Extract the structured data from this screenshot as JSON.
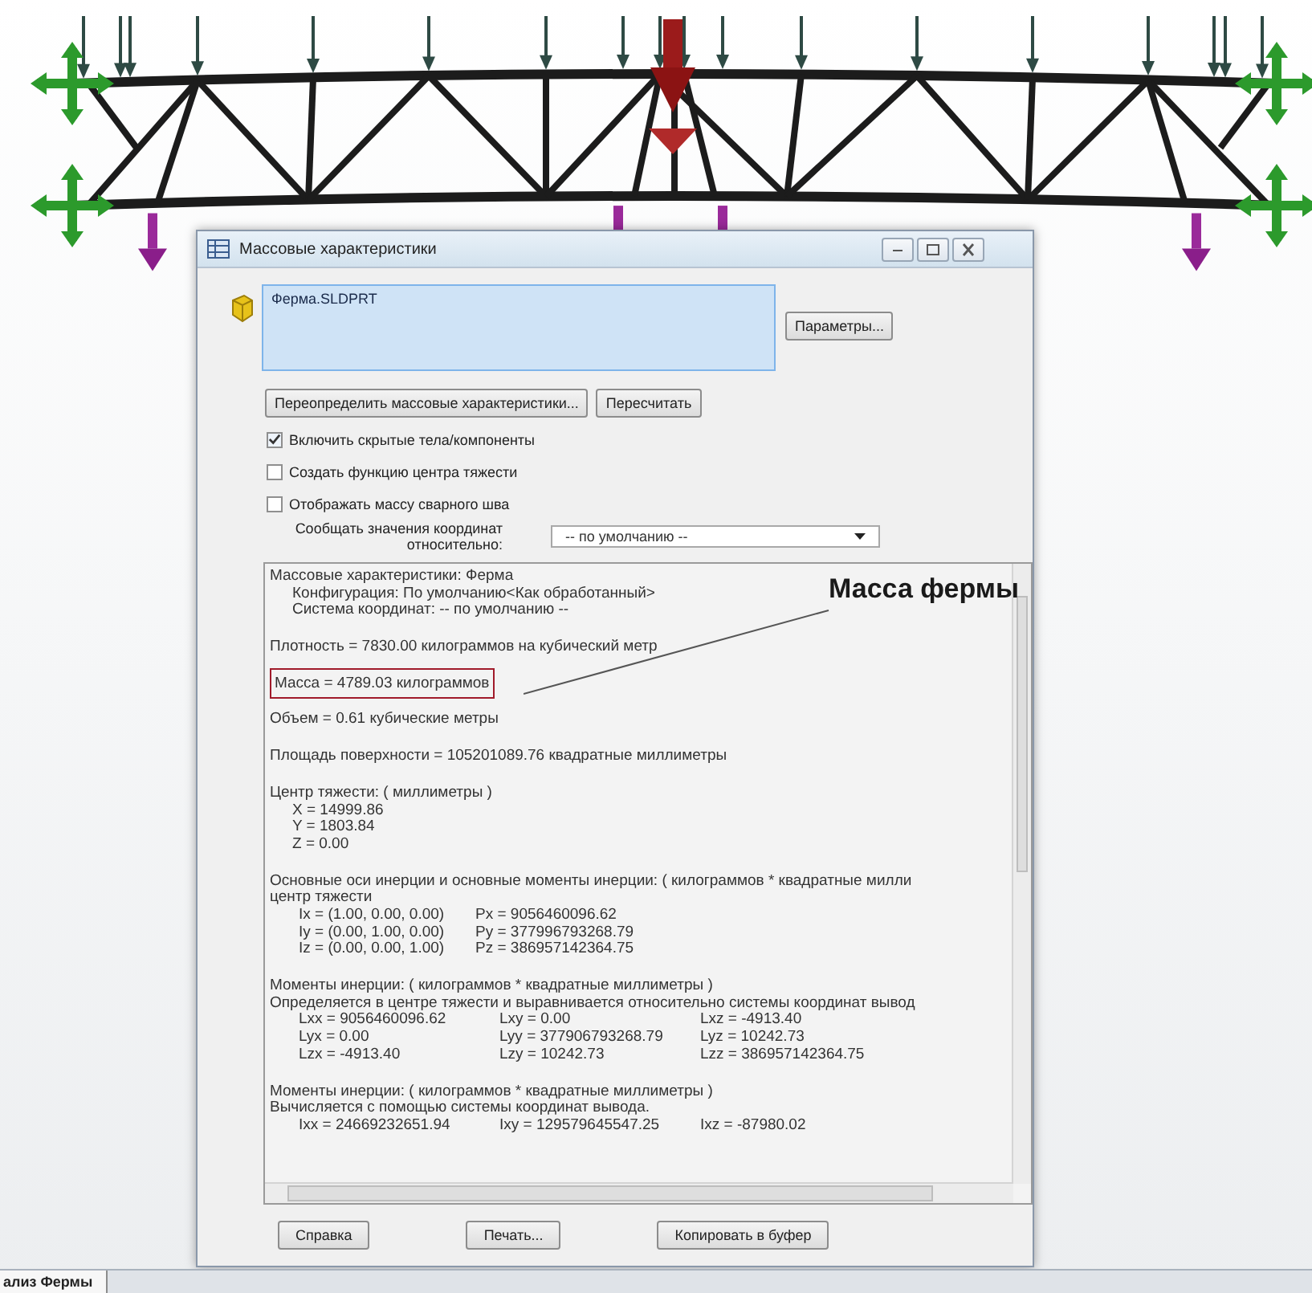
{
  "dialog": {
    "title": "Массовые характеристики",
    "selection": "Ферма.SLDPRT",
    "options_button": "Параметры...",
    "action_buttons": [
      "Переопределить массовые характеристики...",
      "Пересчитать"
    ],
    "checkboxes": [
      {
        "label": "Включить скрытые тела/компоненты",
        "checked": true
      },
      {
        "label": "Создать функцию центра тяжести",
        "checked": false
      },
      {
        "label": "Отображать массу сварного шва",
        "checked": false
      }
    ],
    "coord_label": "Сообщать значения координат относительно:",
    "coord_value": "-- по умолчанию --",
    "report": [
      {
        "kind": "text",
        "text": "Массовые характеристики: Ферма"
      },
      {
        "kind": "indented",
        "text": "Конфигурация: По умолчанию<Как обработанный>"
      },
      {
        "kind": "indented",
        "text": "Система координат: -- по умолчанию --"
      },
      {
        "kind": "gap"
      },
      {
        "kind": "text",
        "text": "Плотность = 7830.00 килограммов на кубический метр"
      },
      {
        "kind": "gap"
      },
      {
        "kind": "boxed",
        "text": "Масса = 4789.03 килограммов"
      },
      {
        "kind": "gap"
      },
      {
        "kind": "text",
        "text": "Объем = 0.61 кубические метры"
      },
      {
        "kind": "gap"
      },
      {
        "kind": "text",
        "text": "Площадь поверхности = 105201089.76  квадратные миллиметры"
      },
      {
        "kind": "gap"
      },
      {
        "kind": "text",
        "text": "Центр тяжести: ( миллиметры )"
      },
      {
        "kind": "indented",
        "text": "X = 14999.86"
      },
      {
        "kind": "indented",
        "text": "Y = 1803.84"
      },
      {
        "kind": "indented",
        "text": "Z = 0.00"
      },
      {
        "kind": "gap"
      },
      {
        "kind": "text",
        "text": "Основные оси инерции и основные моменты инерции: ( килограммов * квадратные милли"
      },
      {
        "kind": "text",
        "text": "центр тяжести"
      },
      {
        "kind": "cols2",
        "cells": [
          "Ix = (1.00,  0.00,  0.00)",
          "Px = 9056460096.62"
        ]
      },
      {
        "kind": "cols2",
        "cells": [
          "Iy = (0.00,  1.00,  0.00)",
          "Py = 377996793268.79"
        ]
      },
      {
        "kind": "cols2",
        "cells": [
          "Iz = (0.00,  0.00,  1.00)",
          "Pz = 386957142364.75"
        ]
      },
      {
        "kind": "gap"
      },
      {
        "kind": "text",
        "text": "Моменты инерции: ( килограммов * квадратные миллиметры )"
      },
      {
        "kind": "text",
        "text": "Определяется в центре тяжести и выравнивается относительно системы координат вывод"
      },
      {
        "kind": "cols3",
        "cells": [
          "Lxx = 9056460096.62",
          "Lxy = 0.00",
          "Lxz = -4913.40"
        ]
      },
      {
        "kind": "cols3",
        "cells": [
          "Lyx = 0.00",
          "Lyy = 377906793268.79",
          "Lyz = 10242.73"
        ]
      },
      {
        "kind": "cols3",
        "cells": [
          "Lzx = -4913.40",
          "Lzy = 10242.73",
          "Lzz = 386957142364.75"
        ]
      },
      {
        "kind": "gap"
      },
      {
        "kind": "text",
        "text": "Моменты инерции: ( килограммов * квадратные миллиметры )"
      },
      {
        "kind": "text",
        "text": "Вычисляется с помощью системы координат вывода."
      },
      {
        "kind": "cols3",
        "cells": [
          "Ixx = 24669232651.94",
          "Ixy = 129579645547.25",
          "Ixz = -87980.02"
        ]
      }
    ],
    "buttons": [
      "Справка",
      "Печать...",
      "Копировать в буфер"
    ]
  },
  "callout": {
    "text": "Масса фермы"
  },
  "bottom_tab": {
    "label": "ализ Фермы"
  }
}
